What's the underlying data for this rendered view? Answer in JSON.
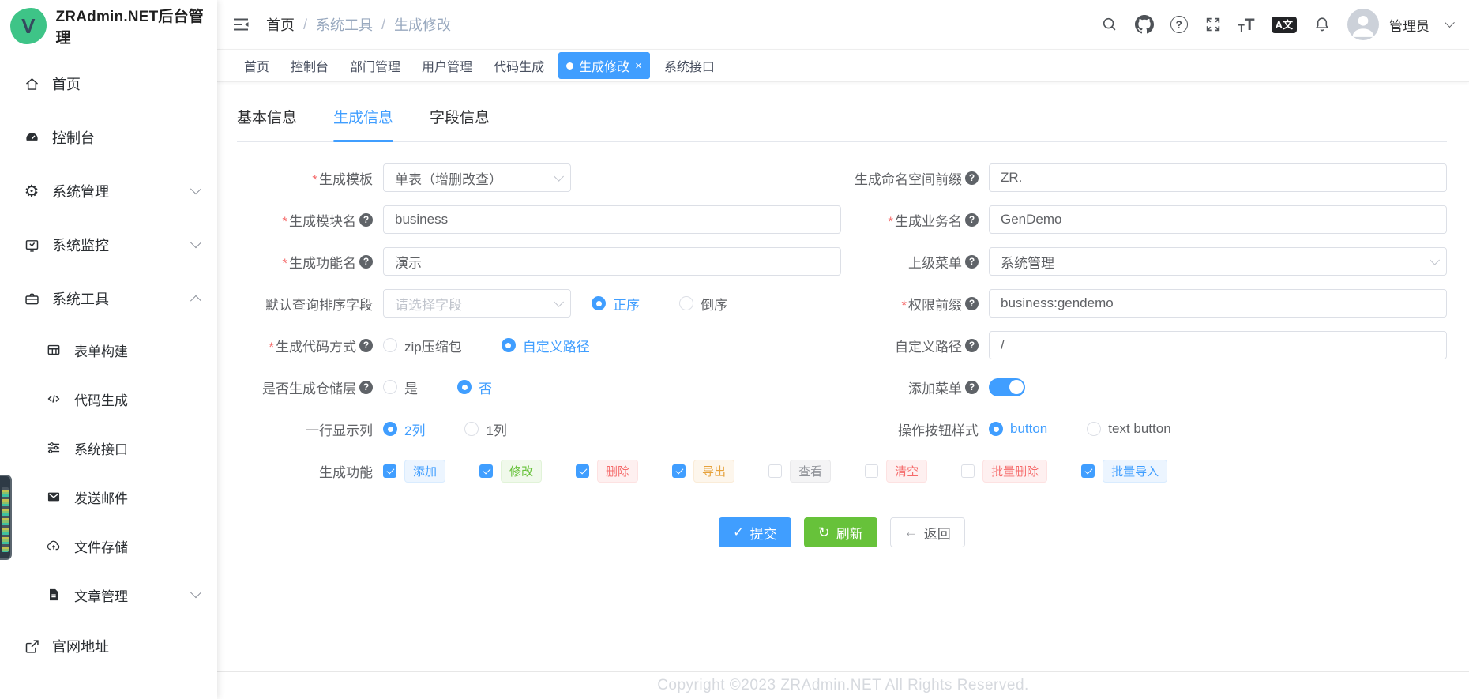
{
  "app": {
    "title": "ZRAdmin.NET后台管理",
    "logo_letter": "V"
  },
  "sidebar": {
    "items": [
      {
        "label": "首页"
      },
      {
        "label": "控制台"
      },
      {
        "label": "系统管理"
      },
      {
        "label": "系统监控"
      },
      {
        "label": "系统工具"
      },
      {
        "label": "表单构建"
      },
      {
        "label": "代码生成"
      },
      {
        "label": "系统接口"
      },
      {
        "label": "发送邮件"
      },
      {
        "label": "文件存储"
      },
      {
        "label": "文章管理"
      },
      {
        "label": "官网地址"
      }
    ]
  },
  "navbar": {
    "breadcrumb": [
      "首页",
      "系统工具",
      "生成修改"
    ],
    "lang_icon_text": "A文",
    "user_name": "管理员"
  },
  "tabbar": {
    "tabs": [
      "首页",
      "控制台",
      "部门管理",
      "用户管理",
      "代码生成",
      "生成修改",
      "系统接口"
    ],
    "active": "生成修改"
  },
  "page_tabs": {
    "basic": "基本信息",
    "gen": "生成信息",
    "fields": "字段信息"
  },
  "form": {
    "template": {
      "label": "生成模板",
      "value": "单表（增删改查）"
    },
    "namespace_prefix": {
      "label": "生成命名空间前缀",
      "value": "ZR."
    },
    "module_name": {
      "label": "生成模块名",
      "value": "business"
    },
    "business_name": {
      "label": "生成业务名",
      "value": "GenDemo"
    },
    "function_name": {
      "label": "生成功能名",
      "value": "演示"
    },
    "parent_menu": {
      "label": "上级菜单",
      "value": "系统管理"
    },
    "sort_field": {
      "label": "默认查询排序字段",
      "placeholder": "请选择字段",
      "asc": "正序",
      "desc": "倒序"
    },
    "permission_prefix": {
      "label": "权限前缀",
      "value": "business:gendemo"
    },
    "gen_method": {
      "label": "生成代码方式",
      "zip": "zip压缩包",
      "custom": "自定义路径"
    },
    "custom_path": {
      "label": "自定义路径",
      "value": "/"
    },
    "repository_layer": {
      "label": "是否生成仓储层",
      "yes": "是",
      "no": "否"
    },
    "add_menu": {
      "label": "添加菜单",
      "state": "on"
    },
    "columns_per_row": {
      "label": "一行显示列",
      "two": "2列",
      "one": "1列"
    },
    "button_style": {
      "label": "操作按钮样式",
      "btn": "button",
      "text_btn": "text button"
    },
    "gen_functions": {
      "label": "生成功能",
      "options": [
        {
          "label": "添加",
          "checked": true,
          "color": "blue"
        },
        {
          "label": "修改",
          "checked": true,
          "color": "green"
        },
        {
          "label": "删除",
          "checked": true,
          "color": "red"
        },
        {
          "label": "导出",
          "checked": true,
          "color": "orange"
        },
        {
          "label": "查看",
          "checked": false,
          "color": "gray"
        },
        {
          "label": "清空",
          "checked": false,
          "color": "red"
        },
        {
          "label": "批量删除",
          "checked": false,
          "color": "red"
        },
        {
          "label": "批量导入",
          "checked": true,
          "color": "blue"
        }
      ]
    }
  },
  "actions": {
    "submit": "提交",
    "refresh": "刷新",
    "back": "返回"
  },
  "footer": {
    "copyright": "Copyright ©2023 ZRAdmin.NET All Rights Reserved."
  },
  "colors": {
    "primary": "#409eff",
    "success": "#67c23a",
    "danger": "#f56c6c",
    "warning": "#e6a23c",
    "info": "#909399"
  }
}
